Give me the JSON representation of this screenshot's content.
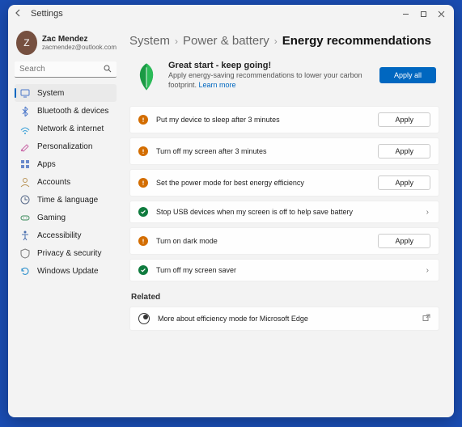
{
  "window": {
    "title": "Settings"
  },
  "profile": {
    "name": "Zac Mendez",
    "email": "zacmendez@outlook.com",
    "initial": "Z"
  },
  "search": {
    "placeholder": "Search"
  },
  "nav": {
    "items": [
      {
        "label": "System",
        "icon": "system",
        "active": true,
        "color": "#4a76c9"
      },
      {
        "label": "Bluetooth & devices",
        "icon": "bluetooth",
        "active": false,
        "color": "#4a76c9"
      },
      {
        "label": "Network & internet",
        "icon": "network",
        "active": false,
        "color": "#3aa0d8"
      },
      {
        "label": "Personalization",
        "icon": "personalization",
        "active": false,
        "color": "#c96aa8"
      },
      {
        "label": "Apps",
        "icon": "apps",
        "active": false,
        "color": "#6a8acb"
      },
      {
        "label": "Accounts",
        "icon": "accounts",
        "active": false,
        "color": "#b99356"
      },
      {
        "label": "Time & language",
        "icon": "time",
        "active": false,
        "color": "#5a6b8a"
      },
      {
        "label": "Gaming",
        "icon": "gaming",
        "active": false,
        "color": "#3a8a5a"
      },
      {
        "label": "Accessibility",
        "icon": "accessibility",
        "active": false,
        "color": "#4a6fae"
      },
      {
        "label": "Privacy & security",
        "icon": "privacy",
        "active": false,
        "color": "#7a7a7a"
      },
      {
        "label": "Windows Update",
        "icon": "update",
        "active": false,
        "color": "#1f89c9"
      }
    ]
  },
  "breadcrumb": {
    "a": "System",
    "b": "Power & battery",
    "c": "Energy recommendations"
  },
  "hero": {
    "title": "Great start - keep going!",
    "desc": "Apply energy-saving recommendations to lower your carbon footprint. ",
    "learn": "Learn more",
    "apply_all": "Apply all"
  },
  "recs": [
    {
      "status": "warn",
      "label": "Put my device to sleep after 3 minutes",
      "action": "apply"
    },
    {
      "status": "warn",
      "label": "Turn off my screen after 3 minutes",
      "action": "apply"
    },
    {
      "status": "warn",
      "label": "Set the power mode for best energy efficiency",
      "action": "apply"
    },
    {
      "status": "ok",
      "label": "Stop USB devices when my screen is off to help save battery",
      "action": "chevron"
    },
    {
      "status": "warn",
      "label": "Turn on dark mode",
      "action": "apply"
    },
    {
      "status": "ok",
      "label": "Turn off my screen saver",
      "action": "chevron"
    }
  ],
  "apply_label": "Apply",
  "related": {
    "heading": "Related",
    "item_label": "More about efficiency mode for Microsoft Edge"
  }
}
